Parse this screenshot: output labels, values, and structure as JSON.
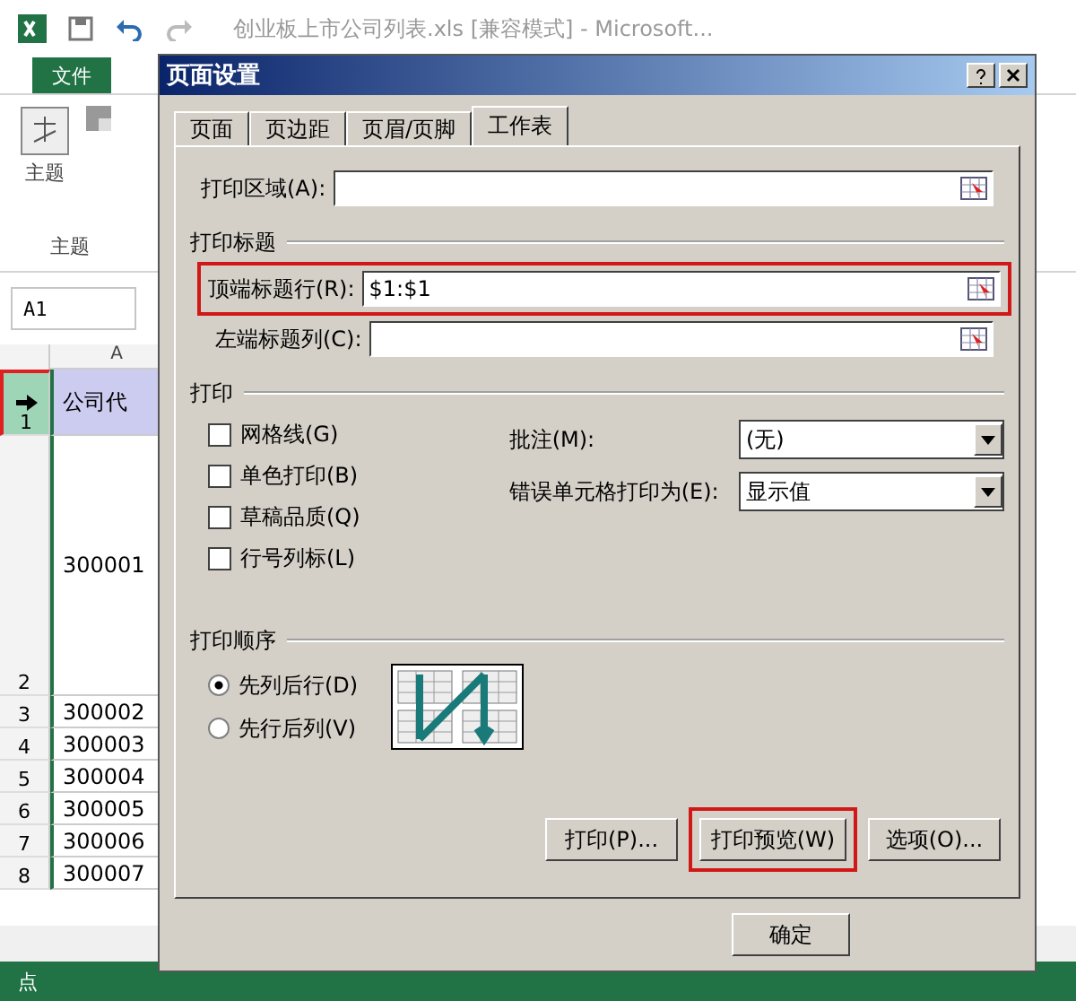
{
  "excel": {
    "title": "创业板上市公司列表.xls  [兼容模式] - Microsoft...",
    "file_tab": "文件",
    "theme_button": "主题",
    "group_label": "主题",
    "name_box": "A1",
    "column_header": "A",
    "rows": [
      {
        "number": "1",
        "value": "公司代",
        "selected": true
      },
      {
        "number": "2",
        "value": "300001",
        "selected": false
      },
      {
        "number": "3",
        "value": "300002",
        "selected": false
      },
      {
        "number": "4",
        "value": "300003",
        "selected": false
      },
      {
        "number": "5",
        "value": "300004",
        "selected": false
      },
      {
        "number": "6",
        "value": "300005",
        "selected": false
      },
      {
        "number": "7",
        "value": "300006",
        "selected": false
      },
      {
        "number": "8",
        "value": "300007",
        "selected": false
      }
    ],
    "status": "点"
  },
  "dialog": {
    "title": "页面设置",
    "tabs": [
      {
        "label": "页面",
        "selected": false
      },
      {
        "label": "页边距",
        "selected": false
      },
      {
        "label": "页眉/页脚",
        "selected": false
      },
      {
        "label": "工作表",
        "selected": true
      }
    ],
    "print_area": {
      "label": "打印区域(A):",
      "highlighted": false
    },
    "print_titles": {
      "heading": "打印标题",
      "fields": [
        {
          "label": "顶端标题行(R):",
          "value": "$1:$1",
          "highlighted": true
        },
        {
          "label": "左端标题列(C):",
          "highlighted": false
        }
      ]
    },
    "print": {
      "heading": "打印",
      "checkboxes": [
        {
          "label": "网格线(G)",
          "checked": false
        },
        {
          "label": "单色打印(B)",
          "checked": false
        },
        {
          "label": "草稿品质(Q)",
          "checked": false
        },
        {
          "label": "行号列标(L)",
          "checked": false
        }
      ],
      "selects": [
        {
          "label": "批注(M):",
          "value": "(无)"
        },
        {
          "label": "错误单元格打印为(E):",
          "value": "显示值"
        }
      ]
    },
    "page_order": {
      "heading": "打印顺序",
      "options": [
        {
          "label": "先列后行(D)",
          "selected": true
        },
        {
          "label": "先行后列(V)",
          "selected": false
        }
      ]
    },
    "buttons": [
      {
        "label": "打印(P)...",
        "highlighted": false
      },
      {
        "label": "打印预览(W)",
        "highlighted": true
      },
      {
        "label": "选项(O)..."
      }
    ],
    "ok": "确定"
  }
}
